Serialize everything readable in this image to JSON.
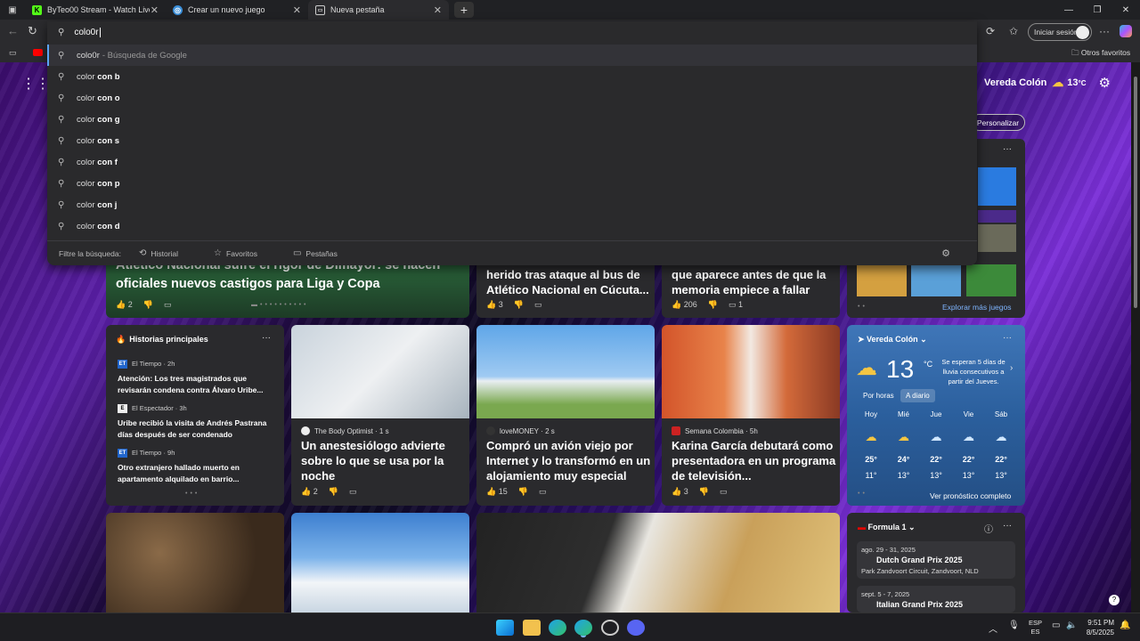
{
  "tabs": [
    {
      "title": "ByTeo00 Stream - Watch Live on",
      "icon": "kick-icon"
    },
    {
      "title": "Crear un nuevo juego",
      "icon": "globe-icon"
    },
    {
      "title": "Nueva pestaña",
      "icon": "newtab-icon"
    }
  ],
  "omnibox": {
    "query": "colo0r",
    "suggestions": [
      {
        "prefix": "colo0r",
        "rest": "",
        "hint": "- Búsqueda de Google"
      },
      {
        "prefix": "color",
        "rest": " con b",
        "hint": ""
      },
      {
        "prefix": "color",
        "rest": " con o",
        "hint": ""
      },
      {
        "prefix": "color",
        "rest": " con g",
        "hint": ""
      },
      {
        "prefix": "color",
        "rest": " con s",
        "hint": ""
      },
      {
        "prefix": "color",
        "rest": " con f",
        "hint": ""
      },
      {
        "prefix": "color",
        "rest": " con p",
        "hint": ""
      },
      {
        "prefix": "color",
        "rest": " con j",
        "hint": ""
      },
      {
        "prefix": "color",
        "rest": " con d",
        "hint": ""
      }
    ],
    "filter_label": "Filtre la búsqueda:",
    "filters": [
      "Historial",
      "Favoritos",
      "Pestañas"
    ]
  },
  "toolbar": {
    "signin": "Iniciar sesión",
    "fav_folder": "Otros favoritos"
  },
  "ntp": {
    "location": "Vereda Colón",
    "temp_top": "13",
    "personalize": "Personalizar",
    "hero": {
      "title": "Atlético Nacional sufre el rigor de Dimayor: se hacen oficiales nuevos castigos para Liga y Copa",
      "likes": "2"
    },
    "card2": {
      "title": "herido tras ataque al bus de Atlético Nacional en Cúcuta...",
      "likes": "3"
    },
    "card3": {
      "title": "que aparece antes de que la memoria empiece a fallar",
      "likes": "206",
      "comments": "1"
    },
    "games_link": "Explorar más juegos",
    "top_stories": {
      "label": "Historias principales",
      "items": [
        {
          "source": "El Tiempo",
          "time": "2h",
          "title": "Atención: Los tres magistrados que revisarán condena contra Álvaro Uribe..."
        },
        {
          "source": "El Espectador",
          "time": "3h",
          "title": "Uribe recibió la visita de Andrés Pastrana días después de ser condenado"
        },
        {
          "source": "El Tiempo",
          "time": "9h",
          "title": "Otro extranjero hallado muerto en apartamento alquilado en barrio..."
        }
      ]
    },
    "news": [
      {
        "source": "The Body Optimist",
        "time": "1 s",
        "title": "Un anestesiólogo advierte sobre lo que se usa por la noche",
        "likes": "2"
      },
      {
        "source": "loveMONEY",
        "time": "2 s",
        "title": "Compró un avión viejo por Internet y lo transformó en un alojamiento muy especial",
        "likes": "15"
      },
      {
        "source": "Semana Colombia",
        "time": "5h",
        "title": "Karina García debutará como presentadora en un programa de televisión...",
        "likes": "3"
      }
    ],
    "weather": {
      "location": "Vereda Colón",
      "temp": "13",
      "unit": "°C",
      "note": "Se esperan 5 días de lluvia consecutivos a partir del Jueves.",
      "tab_hourly": "Por horas",
      "tab_daily": "A diario",
      "days": [
        {
          "d": "Hoy",
          "hi": "25°",
          "lo": "11°"
        },
        {
          "d": "Mié",
          "hi": "24°",
          "lo": "13°"
        },
        {
          "d": "Jue",
          "hi": "22°",
          "lo": "13°"
        },
        {
          "d": "Vie",
          "hi": "22°",
          "lo": "13°"
        },
        {
          "d": "Sáb",
          "hi": "22°",
          "lo": "13°"
        }
      ],
      "forecast_link": "Ver pronóstico completo"
    },
    "f1": {
      "label": "Formula 1",
      "events": [
        {
          "date": "ago. 29 - 31, 2025",
          "name": "Dutch Grand Prix 2025",
          "place": "Park Zandvoort Circuit, Zandvoort, NLD"
        },
        {
          "date": "sept. 5 - 7, 2025",
          "name": "Italian Grand Prix 2025",
          "place": ""
        }
      ]
    }
  },
  "taskbar": {
    "lang1": "ESP",
    "lang2": "ES",
    "time": "9:51 PM",
    "date": "8/5/2025"
  }
}
